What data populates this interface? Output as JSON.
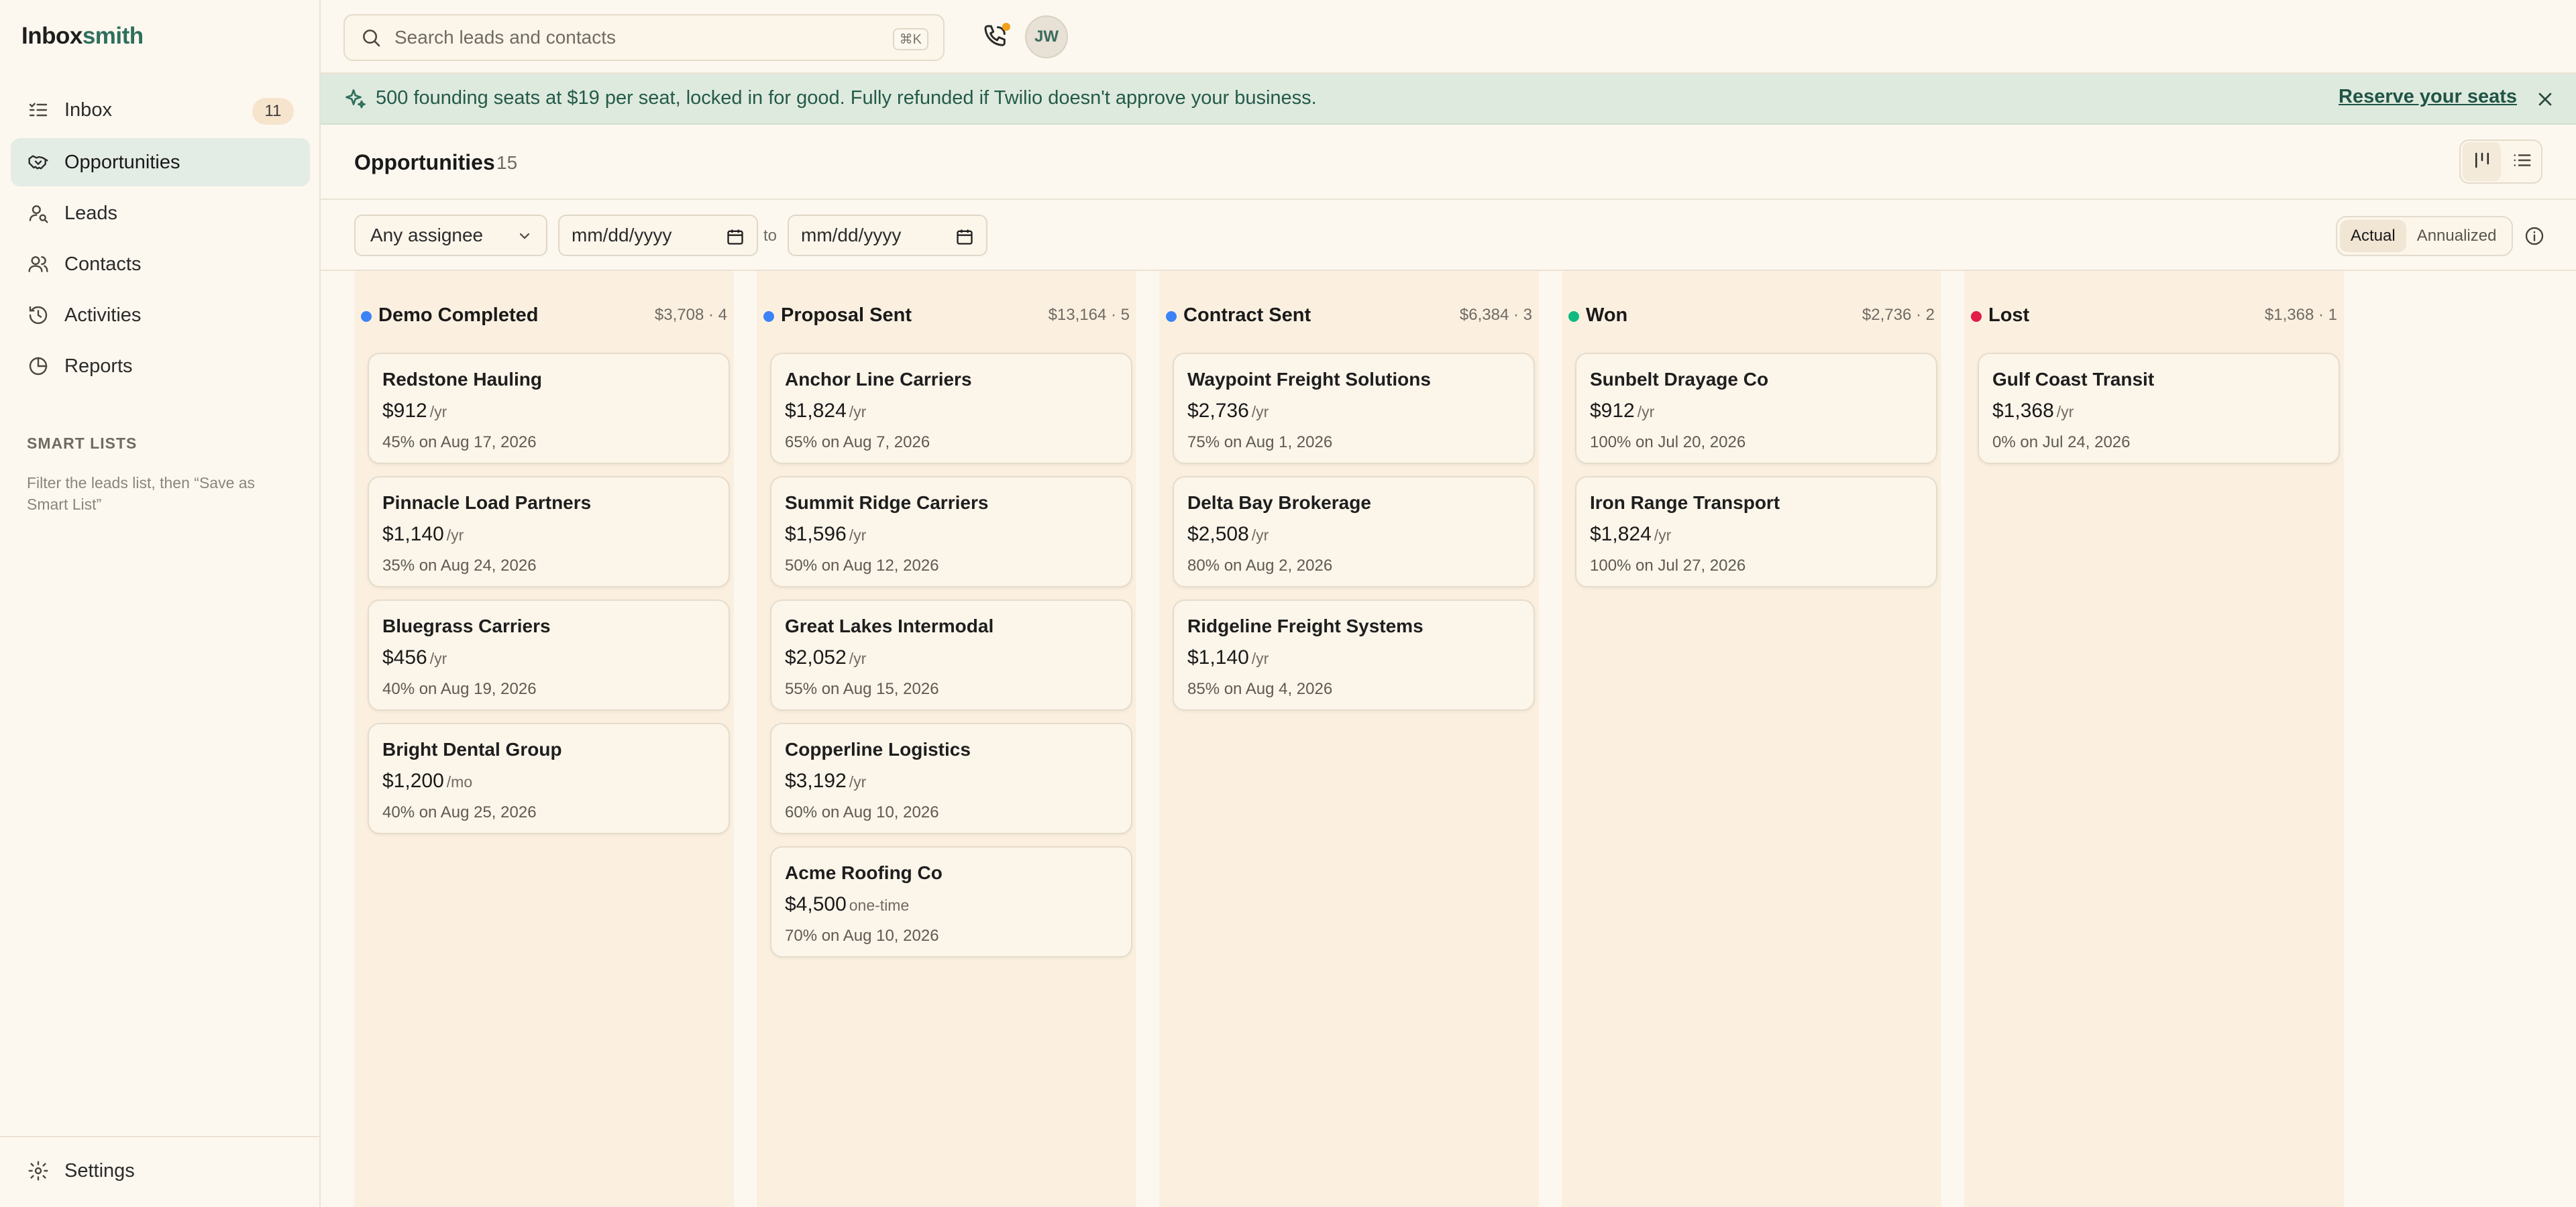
{
  "app": {
    "logo_main": "Inbox",
    "logo_accent": "smith"
  },
  "sidebar": {
    "items": [
      {
        "label": "Inbox",
        "icon": "inbox-list-icon",
        "badge": "11",
        "active": false
      },
      {
        "label": "Opportunities",
        "icon": "handshake-icon",
        "active": true
      },
      {
        "label": "Leads",
        "icon": "user-search-icon",
        "active": false
      },
      {
        "label": "Contacts",
        "icon": "users-icon",
        "active": false
      },
      {
        "label": "Activities",
        "icon": "history-icon",
        "active": false
      },
      {
        "label": "Reports",
        "icon": "pie-chart-icon",
        "active": false
      }
    ],
    "smart_lists_title": "SMART LISTS",
    "smart_lists_hint": "Filter the leads list, then “Save as Smart List”",
    "settings_label": "Settings"
  },
  "topbar": {
    "search_placeholder": "Search leads and contacts",
    "search_shortcut": "⌘K",
    "avatar_initials": "JW"
  },
  "banner": {
    "text": "500 founding seats at $19 per seat, locked in for good. Fully refunded if Twilio doesn't approve your business.",
    "link": "Reserve your seats"
  },
  "page": {
    "title": "Opportunities",
    "count": "15"
  },
  "filters": {
    "assignee": "Any assignee",
    "date_from": "mm/dd/yyyy",
    "to_label": "to",
    "date_to": "mm/dd/yyyy",
    "mode_actual": "Actual",
    "mode_annualized": "Annualized"
  },
  "colors": {
    "accent": "#2f6f5e",
    "banner_bg": "#deeadd",
    "stage_blue": "#3b82f6",
    "stage_green": "#10b981",
    "stage_red": "#e11d48"
  },
  "columns": [
    {
      "name": "Demo Completed",
      "meta": "$3,708 · 4",
      "color": "#3b82f6",
      "cards": [
        {
          "name": "Redstone Hauling",
          "amount": "$912",
          "unit": "/yr",
          "sub": "45% on Aug 17, 2026"
        },
        {
          "name": "Pinnacle Load Partners",
          "amount": "$1,140",
          "unit": "/yr",
          "sub": "35% on Aug 24, 2026"
        },
        {
          "name": "Bluegrass Carriers",
          "amount": "$456",
          "unit": "/yr",
          "sub": "40% on Aug 19, 2026"
        },
        {
          "name": "Bright Dental Group",
          "amount": "$1,200",
          "unit": "/mo",
          "sub": "40% on Aug 25, 2026"
        }
      ]
    },
    {
      "name": "Proposal Sent",
      "meta": "$13,164 · 5",
      "color": "#3b82f6",
      "cards": [
        {
          "name": "Anchor Line Carriers",
          "amount": "$1,824",
          "unit": "/yr",
          "sub": "65% on Aug 7, 2026"
        },
        {
          "name": "Summit Ridge Carriers",
          "amount": "$1,596",
          "unit": "/yr",
          "sub": "50% on Aug 12, 2026"
        },
        {
          "name": "Great Lakes Intermodal",
          "amount": "$2,052",
          "unit": "/yr",
          "sub": "55% on Aug 15, 2026"
        },
        {
          "name": "Copperline Logistics",
          "amount": "$3,192",
          "unit": "/yr",
          "sub": "60% on Aug 10, 2026"
        },
        {
          "name": "Acme Roofing Co",
          "amount": "$4,500",
          "unit": "one-time",
          "sub": "70% on Aug 10, 2026"
        }
      ]
    },
    {
      "name": "Contract Sent",
      "meta": "$6,384 · 3",
      "color": "#3b82f6",
      "cards": [
        {
          "name": "Waypoint Freight Solutions",
          "amount": "$2,736",
          "unit": "/yr",
          "sub": "75% on Aug 1, 2026"
        },
        {
          "name": "Delta Bay Brokerage",
          "amount": "$2,508",
          "unit": "/yr",
          "sub": "80% on Aug 2, 2026"
        },
        {
          "name": "Ridgeline Freight Systems",
          "amount": "$1,140",
          "unit": "/yr",
          "sub": "85% on Aug 4, 2026"
        }
      ]
    },
    {
      "name": "Won",
      "meta": "$2,736 · 2",
      "color": "#10b981",
      "cards": [
        {
          "name": "Sunbelt Drayage Co",
          "amount": "$912",
          "unit": "/yr",
          "sub": "100% on Jul 20, 2026"
        },
        {
          "name": "Iron Range Transport",
          "amount": "$1,824",
          "unit": "/yr",
          "sub": "100% on Jul 27, 2026"
        }
      ]
    },
    {
      "name": "Lost",
      "meta": "$1,368 · 1",
      "color": "#e11d48",
      "cards": [
        {
          "name": "Gulf Coast Transit",
          "amount": "$1,368",
          "unit": "/yr",
          "sub": "0% on Jul 24, 2026"
        }
      ]
    }
  ]
}
